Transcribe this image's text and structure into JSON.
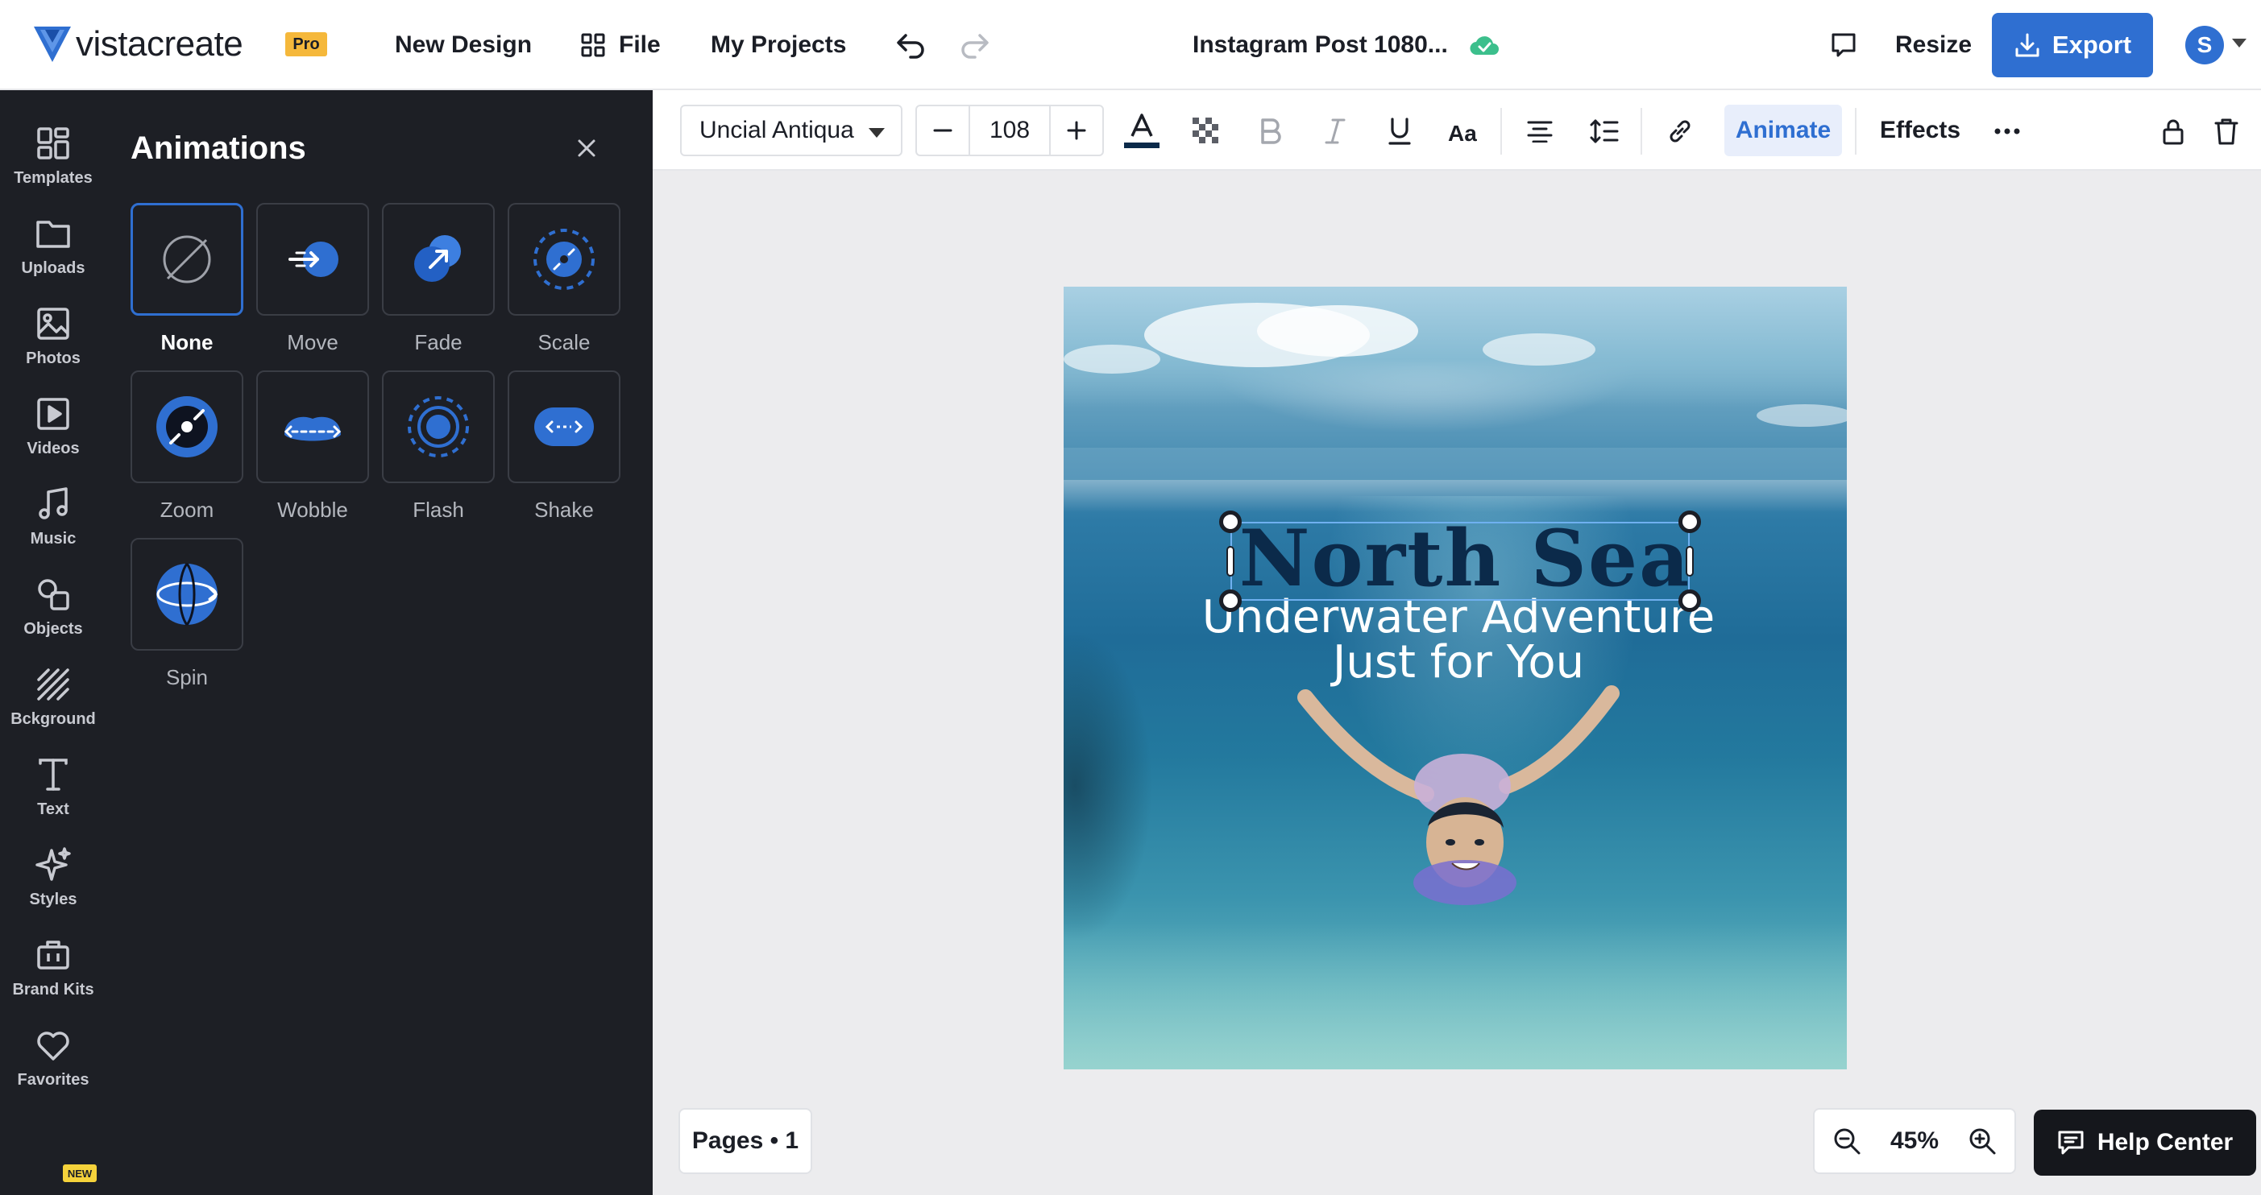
{
  "app": {
    "brand": "vistacreate",
    "pro_badge": "Pro",
    "nav": {
      "new_design": "New Design",
      "file": "File",
      "my_projects": "My Projects"
    },
    "doc_title": "Instagram Post 1080...",
    "resize": "Resize",
    "export": "Export",
    "avatar_initial": "S",
    "accent_color": "#2f6fd1"
  },
  "rail": {
    "items": [
      {
        "label": "Templates",
        "icon": "templates-icon"
      },
      {
        "label": "Uploads",
        "icon": "folder-icon"
      },
      {
        "label": "Photos",
        "icon": "image-icon"
      },
      {
        "label": "Videos",
        "icon": "play-icon"
      },
      {
        "label": "Music",
        "icon": "music-icon"
      },
      {
        "label": "Objects",
        "icon": "shapes-icon"
      },
      {
        "label": "Bckground",
        "icon": "hatch-icon"
      },
      {
        "label": "Text",
        "icon": "text-icon"
      },
      {
        "label": "Styles",
        "icon": "sparkle-icon"
      },
      {
        "label": "Brand Kits",
        "icon": "briefcase-icon"
      },
      {
        "label": "Favorites",
        "icon": "heart-icon"
      }
    ],
    "new_badge": "NEW"
  },
  "panel": {
    "title": "Animations",
    "items": [
      {
        "label": "None",
        "selected": true
      },
      {
        "label": "Move"
      },
      {
        "label": "Fade"
      },
      {
        "label": "Scale"
      },
      {
        "label": "Zoom"
      },
      {
        "label": "Wobble"
      },
      {
        "label": "Flash"
      },
      {
        "label": "Shake"
      },
      {
        "label": "Spin"
      }
    ]
  },
  "toolbar": {
    "font": "Uncial Antiqua",
    "font_size": "108",
    "animate": "Animate",
    "effects": "Effects",
    "text_color": "#0b2a4a"
  },
  "canvas": {
    "headline": "North Sea",
    "subline_1": "Underwater Adventure",
    "subline_2": "Just for You"
  },
  "bottom": {
    "pages": "Pages • 1",
    "zoom": "45%",
    "help": "Help Center"
  }
}
